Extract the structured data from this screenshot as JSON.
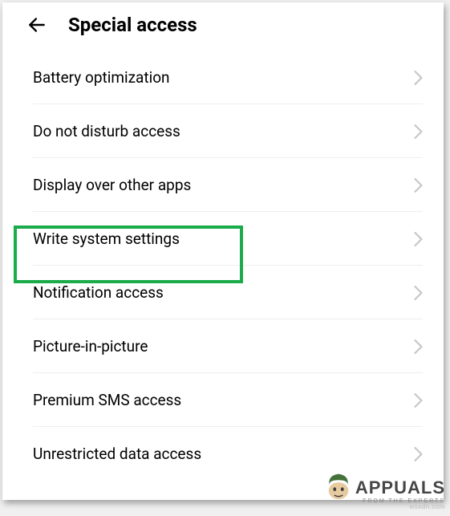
{
  "header": {
    "title": "Special access"
  },
  "items": [
    {
      "label": "Battery optimization"
    },
    {
      "label": "Do not disturb access"
    },
    {
      "label": "Display over other apps"
    },
    {
      "label": "Write system settings"
    },
    {
      "label": "Notification access"
    },
    {
      "label": "Picture-in-picture"
    },
    {
      "label": "Premium SMS access"
    },
    {
      "label": "Unrestricted data access"
    }
  ],
  "highlight_index": 3,
  "watermark": {
    "brand": "APPUALS",
    "tagline": "FROM THE EXPERTS",
    "source": "wsxdn.com"
  }
}
